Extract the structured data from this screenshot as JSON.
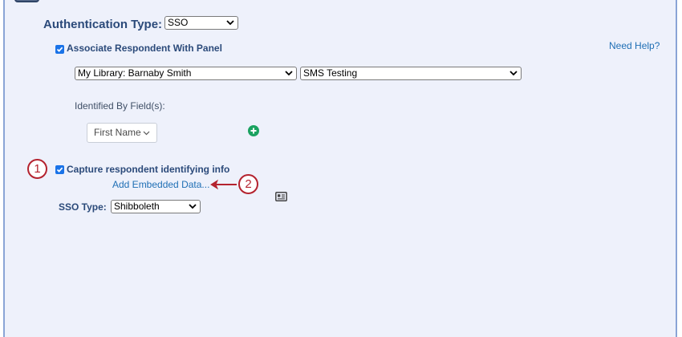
{
  "auth": {
    "label": "Authentication Type:",
    "type_value": "SSO"
  },
  "panel_assoc": {
    "checkbox_label": "Associate Respondent With Panel",
    "checked": true,
    "help_link": "Need Help?",
    "library_value": "My Library: Barnaby Smith",
    "panel_value": "SMS Testing"
  },
  "identified": {
    "label": "Identified By Field(s):",
    "field_value": "First Name"
  },
  "capture": {
    "checkbox_label": "Capture respondent identifying info",
    "checked": true,
    "embedded_link": "Add Embedded Data..."
  },
  "sso": {
    "label": "SSO Type:",
    "type_value": "Shibboleth"
  },
  "callouts": [
    "1",
    "2"
  ],
  "colors": {
    "accent": "#1a73e8",
    "callout": "#b4232f",
    "link": "#1f6fb5",
    "add": "#1aa260",
    "panel_bg": "#eef1fb"
  },
  "icons": [
    "checkmark-icon",
    "chevron-down-icon",
    "plus-circle-icon",
    "arrow-left-icon",
    "id-card-icon"
  ]
}
